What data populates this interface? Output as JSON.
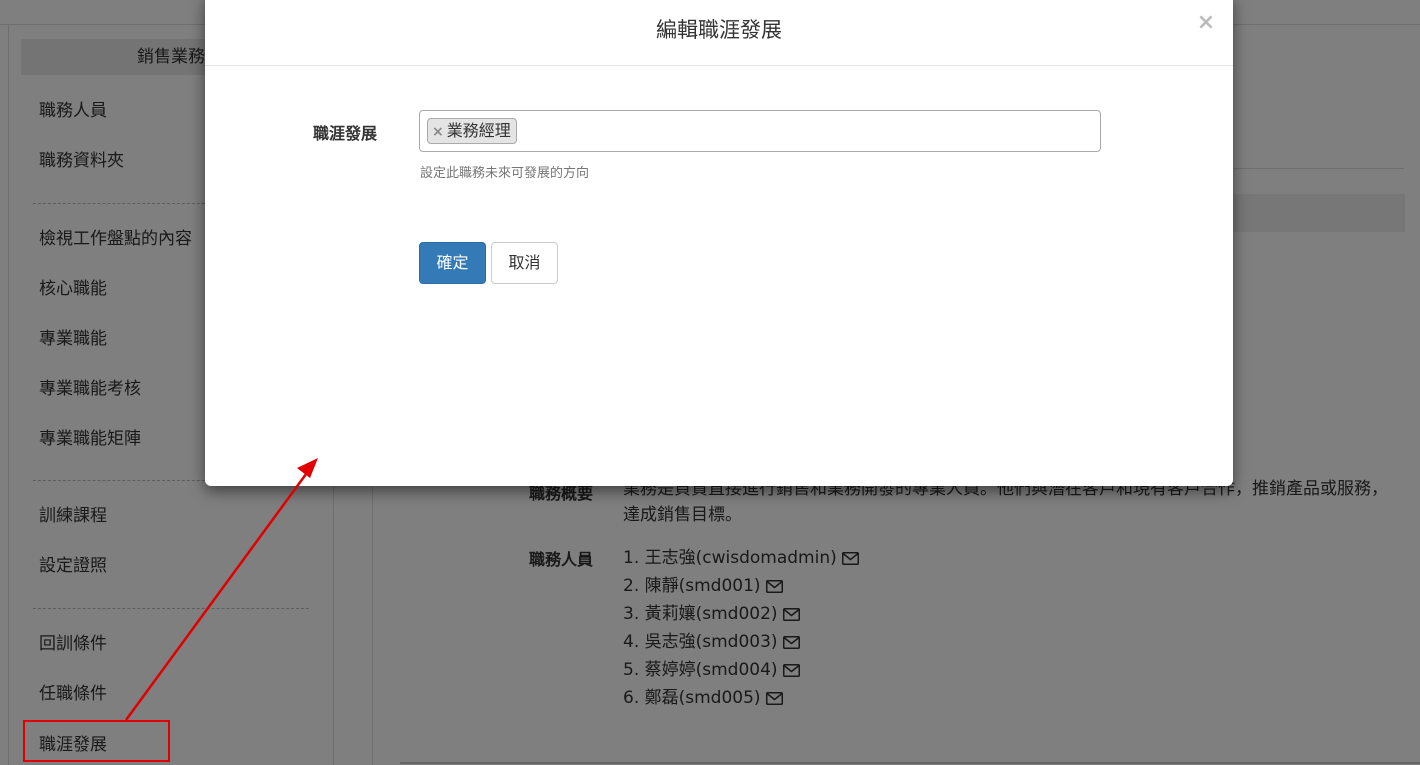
{
  "sidebar": {
    "title": "銷售業務",
    "items": [
      {
        "label": "職務人員"
      },
      {
        "label": "職務資料夾"
      },
      {
        "label": "檢視工作盤點的內容"
      },
      {
        "label": "核心職能"
      },
      {
        "label": "專業職能"
      },
      {
        "label": "專業職能考核"
      },
      {
        "label": "專業職能矩陣"
      },
      {
        "label": "訓練課程"
      },
      {
        "label": "設定證照"
      },
      {
        "label": "回訓條件"
      },
      {
        "label": "任職條件"
      },
      {
        "label": "職涯發展"
      }
    ]
  },
  "content": {
    "overview_label": "職務概要",
    "overview_text": "業務是負責直接進行銷售和業務開發的專業人員。他們與潛在客戶和現有客戶合作，推銷產品或服務，達成銷售目標。",
    "members_label": "職務人員",
    "members": [
      "1. 王志強(cwisdomadmin)",
      "2. 陳靜(smd001)",
      "3. 黃莉孃(smd002)",
      "4. 吳志強(smd003)",
      "5. 蔡婷婷(smd004)",
      "6. 鄭磊(smd005)"
    ]
  },
  "modal": {
    "title": "編輯職涯發展",
    "close": "×",
    "field_label": "職涯發展",
    "tags": [
      "業務經理"
    ],
    "tag_remove": "×",
    "help_text": "設定此職務未來可發展的方向",
    "confirm_label": "確定",
    "cancel_label": "取消"
  },
  "colors": {
    "primary": "#337ab7",
    "annotation": "#e00000",
    "backdrop": "rgba(0,0,0,0.5)"
  },
  "icons": {
    "member_action": "envelope-icon",
    "modal_close": "close-icon"
  }
}
